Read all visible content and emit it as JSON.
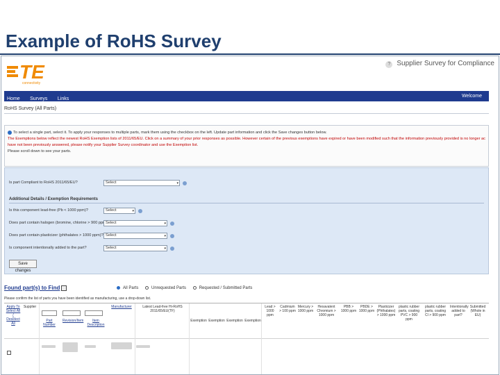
{
  "slide": {
    "title": "Example of RoHS Survey"
  },
  "header": {
    "logo_text": "TE",
    "logo_sub": "connectivity",
    "survey_title": "Supplier Survey for Compliance",
    "help_glyph": "?"
  },
  "nav": {
    "items": [
      "Home",
      "Surveys",
      "Links"
    ],
    "welcome": "Welcome"
  },
  "breadcrumb": "RoHS Survey (All Parts)",
  "instructions": {
    "line1": "To select a single part, select it. To apply your responses to multiple parts, mark them using the checkbox on the left. Update part information and click the Save changes button below.",
    "line2": "The Exemptions below reflect the newest RoHS Exemption lists of 2011/65/EU. Click on a summary of your prior responses as possible. However certain of the previous exemptions have expired or have been modified such that the information previously provided is no longer accurate and will require re-entry. For those which",
    "line3": "have not been previously answered, please notify your Supplier Survey coordinator and use the Exemption list.",
    "line4": "Please scroll down to see your parts."
  },
  "form": {
    "rows": [
      {
        "label": "Is part Compliant to RoHS 2011/65/EU?",
        "value": "Select"
      },
      {
        "label": "Is this component lead-free (Pb < 1000 ppm)?",
        "value": "Select"
      },
      {
        "label": "Does part contain halogen (bromine, chlorine > 900 ppm)?",
        "value": "Select"
      },
      {
        "label": "Does part contain plasticizer (phthalates > 1000 ppm)?",
        "value": "Select"
      },
      {
        "label": "Is component intentionally added to the part?",
        "value": "Select"
      }
    ],
    "additional_title": "Additional Details / Exemption Requirements",
    "save_label": "Save changes"
  },
  "parts": {
    "title": "Found part(s) to Find",
    "radios": [
      "All Parts",
      "Unrequested Parts",
      "Requested / Submitted Parts"
    ],
    "note": "Please confirm the list of parts you have been identified as manufacturing, use a drop-down list.",
    "columns": [
      "Apply To Select All / Deselect All",
      "Supplier",
      "Part Number",
      "Revision/Item",
      "Item Description",
      "Manufacturer",
      "Latest Lead-free Hi-RoHS 2011/65/EU(TF)",
      "Exemption",
      "Exemption",
      "Exemption",
      "Exemption",
      "Lead > 1000 ppm",
      "Cadmium > 100 ppm",
      "Mercury > 1000 ppm",
      "Hexavalent Chromium > 1000 ppm",
      "PBB > 1000 ppm",
      "PBDE > 1000 ppm",
      "Plasticizer (Phthalates) > 1000 ppm",
      "plastic rubber parts, coating PVC > 900 ppm",
      "plastic rubber parts, coating Cl > 900 ppm",
      "Intentionally added to part?",
      "Submitted (Whole in EU)"
    ]
  }
}
